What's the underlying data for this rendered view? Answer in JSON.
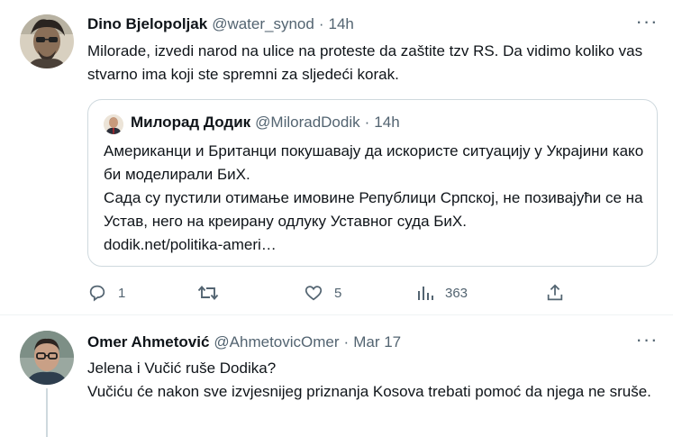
{
  "tweets": [
    {
      "name": "Dino Bjelopoljak",
      "handle": "@water_synod",
      "time": "14h",
      "text": "Milorade, izvedi narod na ulice na proteste da zaštite tzv RS. Da vidimo koliko vas stvarno ima koji ste spremni za sljedeći korak.",
      "quote": {
        "name": "Милорад Додик",
        "handle": "@MiloradDodik",
        "time": "14h",
        "line1": "Американци и Британци покушавају да искористе ситуацију у Украјини како би моделирали БиХ.",
        "line2": "Сада су пустили отимање имовине Републици Српској, не позивајући се на Устав, него на креирану одлуку Уставног суда БиХ.",
        "link": "dodik.net/politika-ameri…"
      },
      "actions": {
        "replies": "1",
        "retweets": "",
        "likes": "5",
        "views": "363"
      }
    },
    {
      "name": "Omer Ahmetović",
      "handle": "@AhmetovicOmer",
      "time": "Mar 17",
      "line1": "Jelena i Vučić ruše Dodika?",
      "line2": "Vučiću će nakon sve izvjesnijeg priznanja Kosova trebati pomoć da njega ne sruše."
    }
  ],
  "ui": {
    "separator": "·",
    "more": "···"
  },
  "colors": {
    "text": "#0f1419",
    "secondary": "#536471",
    "border": "#cfd9de"
  }
}
